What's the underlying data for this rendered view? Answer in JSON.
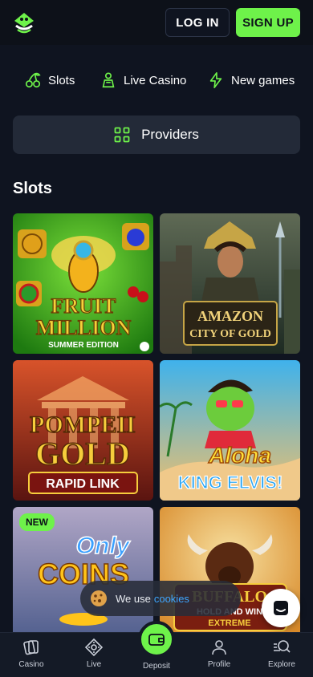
{
  "header": {
    "login_label": "LOG IN",
    "signup_label": "SIGN UP"
  },
  "categories": [
    {
      "label": "Slots",
      "icon": "cherries-icon"
    },
    {
      "label": "Live Casino",
      "icon": "dealer-icon"
    },
    {
      "label": "New games",
      "icon": "lightning-icon"
    }
  ],
  "providers": {
    "label": "Providers",
    "icon": "grid-icon"
  },
  "section": {
    "title": "Slots"
  },
  "games": [
    {
      "name": "Fruit Million",
      "line1": "FRUIT",
      "line2": "MILLION",
      "sub": "SUMMER EDITION"
    },
    {
      "name": "Amazon City of Gold",
      "line1": "AMAZON",
      "line2": "CITY OF GOLD"
    },
    {
      "name": "Pompeii Gold",
      "line1": "POMPEII",
      "line2": "GOLD",
      "sub": "RAPID LINK"
    },
    {
      "name": "Aloha King Elvis",
      "line1": "Aloha",
      "line2": "KING ELVIS!"
    },
    {
      "name": "Only Coins",
      "badge": "NEW",
      "line1": "Only",
      "line2": "COINS"
    },
    {
      "name": "Buffalo Hold and Win Extreme",
      "line1": "BUFFALO",
      "line2": "HOLD AND WIN",
      "sub": "EXTREME"
    }
  ],
  "cookie": {
    "text": "We use",
    "link": "cookies"
  },
  "bottom_nav": [
    {
      "label": "Casino",
      "icon": "cards-icon"
    },
    {
      "label": "Live",
      "icon": "chip-icon"
    },
    {
      "label": "Deposit",
      "icon": "wallet-icon"
    },
    {
      "label": "Profile",
      "icon": "user-icon"
    },
    {
      "label": "Explore",
      "icon": "search-icon"
    }
  ],
  "colors": {
    "accent": "#6ef24a",
    "background": "#0f1420",
    "surface": "#232a38"
  }
}
